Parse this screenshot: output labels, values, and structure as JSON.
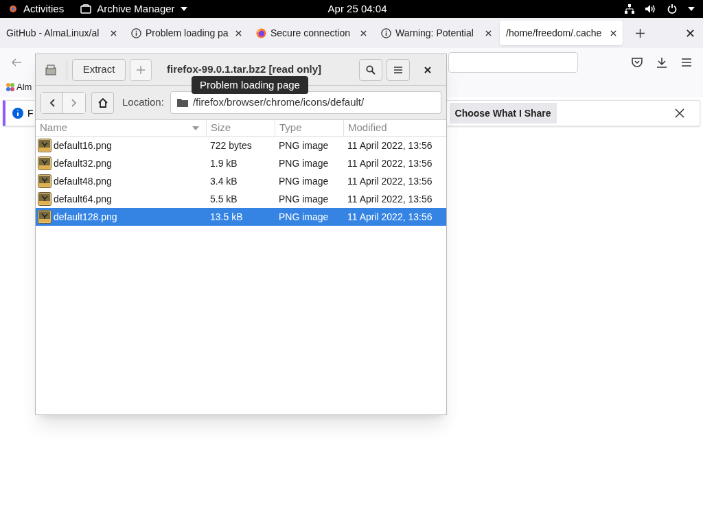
{
  "top_bar": {
    "activities": "Activities",
    "app_menu": "Archive Manager",
    "clock": "Apr 25  04:04"
  },
  "browser": {
    "tabs": [
      {
        "label": "GitHub - AlmaLinux/al",
        "kind": "plain",
        "selected": false
      },
      {
        "label": "Problem loading pa",
        "kind": "info",
        "selected": false
      },
      {
        "label": "Secure connection",
        "kind": "browser",
        "selected": false
      },
      {
        "label": "Warning: Potential",
        "kind": "info",
        "selected": false
      },
      {
        "label": "/home/freedom/.cache",
        "kind": "plain",
        "selected": true
      }
    ],
    "bookmark": "Alm",
    "notification": {
      "text": "F",
      "button": "Choose What I Share"
    }
  },
  "archive_window": {
    "extract": "Extract",
    "title": "firefox-99.0.1.tar.bz2 [read only]",
    "tooltip": "Problem loading page",
    "location_label": "Location:",
    "path": "/firefox/browser/chrome/icons/default/",
    "columns": [
      "Name",
      "Size",
      "Type",
      "Modified"
    ],
    "rows": [
      {
        "name": "default16.png",
        "size": "722 bytes",
        "type": "PNG image",
        "modified": "11 April 2022, 13:56",
        "selected": false
      },
      {
        "name": "default32.png",
        "size": "1.9 kB",
        "type": "PNG image",
        "modified": "11 April 2022, 13:56",
        "selected": false
      },
      {
        "name": "default48.png",
        "size": "3.4 kB",
        "type": "PNG image",
        "modified": "11 April 2022, 13:56",
        "selected": false
      },
      {
        "name": "default64.png",
        "size": "5.5 kB",
        "type": "PNG image",
        "modified": "11 April 2022, 13:56",
        "selected": false
      },
      {
        "name": "default128.png",
        "size": "13.5 kB",
        "type": "PNG image",
        "modified": "11 April 2022, 13:56",
        "selected": true
      }
    ]
  }
}
